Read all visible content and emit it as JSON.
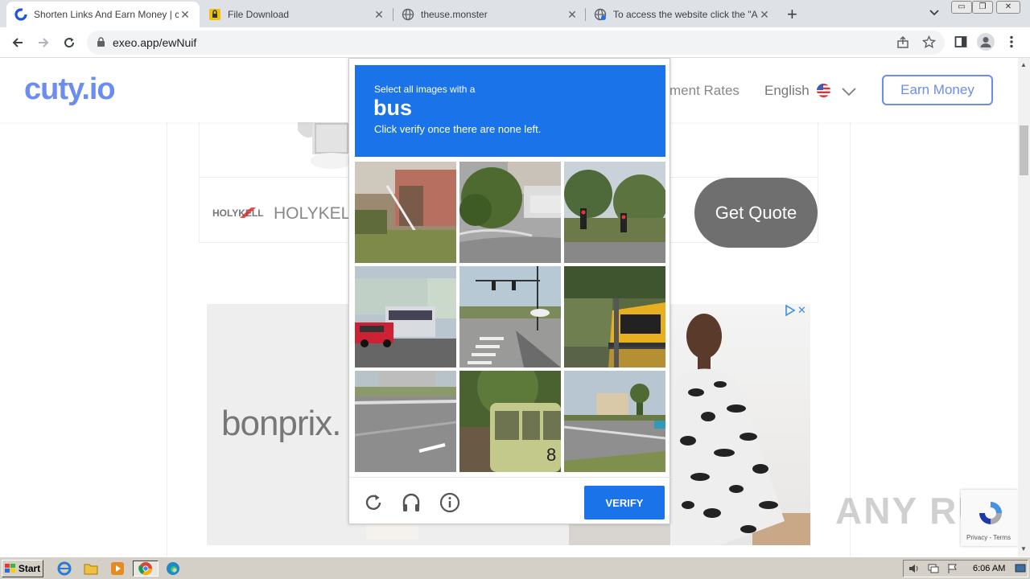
{
  "browser": {
    "tabs": [
      {
        "title": "Shorten Links And Earn Money | cuty.io",
        "active": true
      },
      {
        "title": "File Download",
        "active": false
      },
      {
        "title": "theuse.monster",
        "active": false
      },
      {
        "title": "To access the website click the \"Allow\"",
        "active": false
      }
    ],
    "new_tab": "+",
    "url": "exeo.app/ewNuif"
  },
  "site": {
    "logo": "cuty.io",
    "nav_partial": "ment Rates",
    "language": "English",
    "earn_button": "Earn Money"
  },
  "ads": {
    "holykell_logo": "HOLYKELL",
    "holykell_text": "HOLYKELL",
    "get_quote": "Get Quote",
    "bonprix": "bonprix."
  },
  "captcha": {
    "line1": "Select all images with a",
    "target": "bus",
    "line3": "Click verify once there are none left.",
    "verify": "VERIFY"
  },
  "watermark": "ANY RUN",
  "recaptcha_badge": "Privacy - Terms",
  "taskbar": {
    "start": "Start",
    "clock": "6:06 AM"
  }
}
